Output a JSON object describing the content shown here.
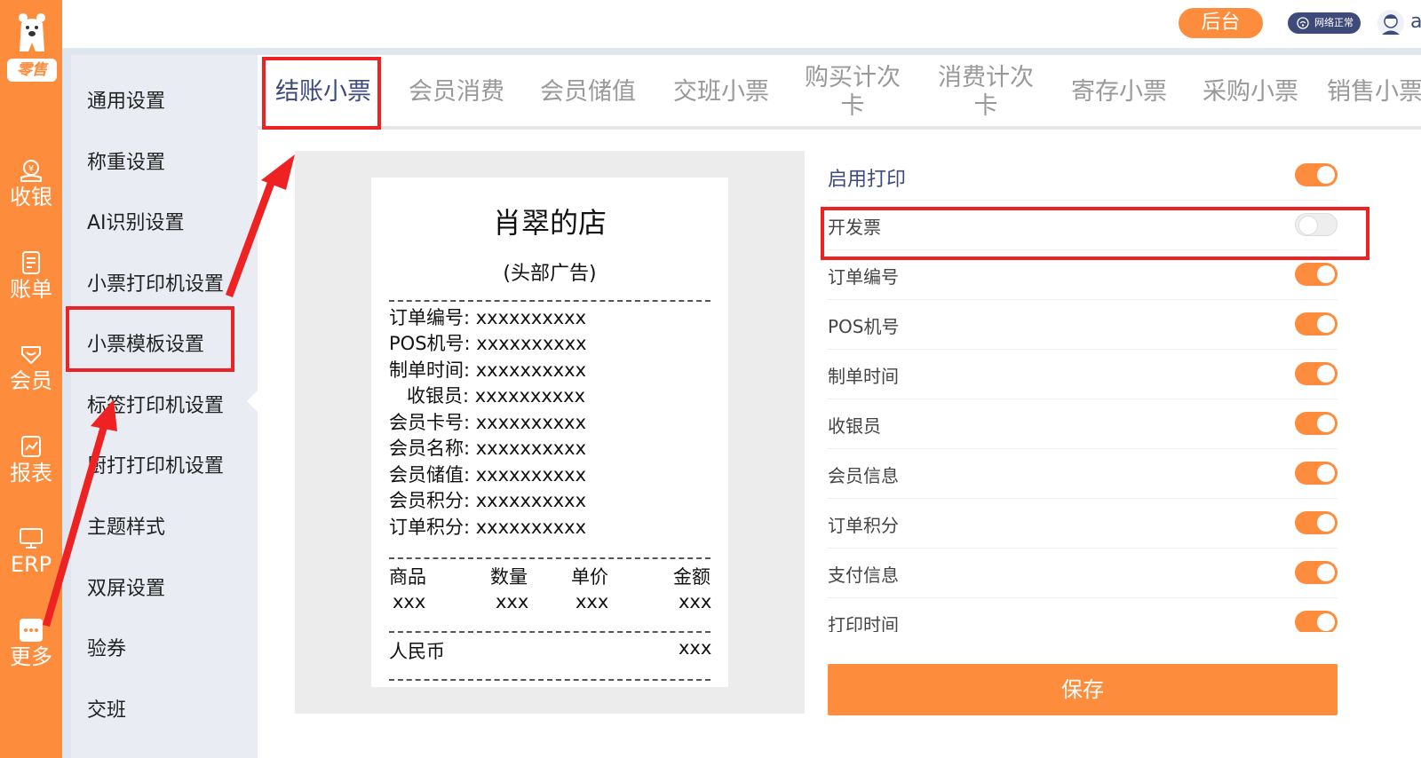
{
  "rail": {
    "logo_text": "零售",
    "items": [
      {
        "label": "收银",
        "icon": "cashier-icon"
      },
      {
        "label": "账单",
        "icon": "bill-icon"
      },
      {
        "label": "会员",
        "icon": "member-icon"
      },
      {
        "label": "报表",
        "icon": "report-icon"
      },
      {
        "label": "ERP",
        "icon": "erp-monitor-icon"
      },
      {
        "label": "更多",
        "icon": "more-icon"
      }
    ]
  },
  "header": {
    "backend_label": "后台",
    "network_status": "网络正常",
    "username": "admin"
  },
  "settings_menu": [
    "通用设置",
    "称重设置",
    "AI识别设置",
    "小票打印机设置",
    "小票模板设置",
    "标签打印机设置",
    "厨打打印机设置",
    "主题样式",
    "双屏设置",
    "验券",
    "交班"
  ],
  "tabs": [
    {
      "label": "结账小票",
      "active": true
    },
    {
      "label": "会员消费"
    },
    {
      "label": "会员储值"
    },
    {
      "label": "交班小票"
    },
    {
      "label": "购买计次\n卡"
    },
    {
      "label": "消费计次\n卡"
    },
    {
      "label": "寄存小票"
    },
    {
      "label": "采购小票"
    },
    {
      "label": "销售小票"
    }
  ],
  "receipt": {
    "shop_name": "肖翠的店",
    "header_ad": "(头部广告)",
    "fields": [
      "订单编号: xxxxxxxxxx",
      "POS机号: xxxxxxxxxx",
      "制单时间: xxxxxxxxxx",
      "收银员: xxxxxxxxxx",
      "会员卡号: xxxxxxxxxx",
      "会员名称: xxxxxxxxxx",
      "会员储值: xxxxxxxxxx",
      "会员积分: xxxxxxxxxx",
      "订单积分: xxxxxxxxxx"
    ],
    "columns": [
      "商品",
      "数量",
      "单价",
      "金额"
    ],
    "row": [
      "xxx",
      "xxx",
      "xxx",
      "xxx"
    ],
    "currency_label": "人民币",
    "currency_value": "xxx"
  },
  "options": [
    {
      "label": "启用打印",
      "on": true
    },
    {
      "label": "开发票",
      "on": false
    },
    {
      "label": "订单编号",
      "on": true
    },
    {
      "label": "POS机号",
      "on": true
    },
    {
      "label": "制单时间",
      "on": true
    },
    {
      "label": "收银员",
      "on": true
    },
    {
      "label": "会员信息",
      "on": true
    },
    {
      "label": "订单积分",
      "on": true
    },
    {
      "label": "支付信息",
      "on": true
    },
    {
      "label": "打印时间",
      "on": true
    }
  ],
  "save_label": "保存",
  "colors": {
    "accent": "#fd8c3d",
    "navy": "#3e4b7a",
    "annotation": "#ee2222"
  }
}
